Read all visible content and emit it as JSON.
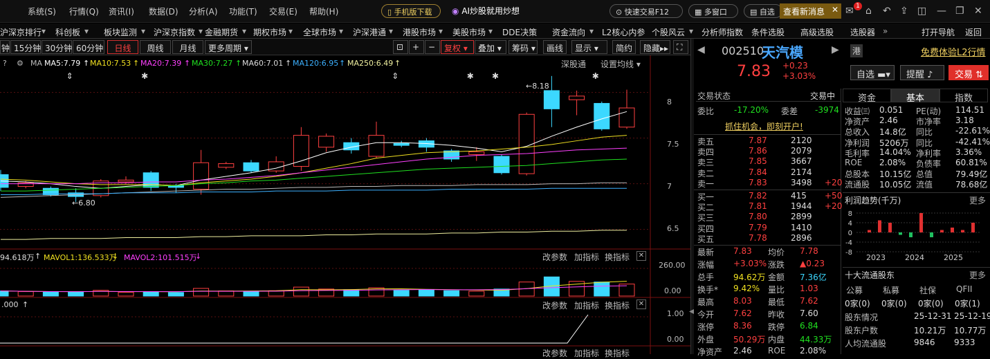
{
  "menubar": {
    "items": [
      "系统(S)",
      "行情(Q)",
      "资讯(I)",
      "数据(D)",
      "分析(A)",
      "功能(T)",
      "交易(E)",
      "帮助(H)"
    ],
    "mobile_btn": "手机版下载",
    "ai_btn": "AI炒股就用炒想",
    "fast_trade": "快速交易F12",
    "multi_window": "多窗口",
    "self_select": "自选",
    "new_msg": "查看新消息",
    "badge": "1"
  },
  "navbar": {
    "items": [
      "沪深京排行",
      "科创板",
      "板块监测",
      "沪深京指数",
      "金融期货",
      "期权市场",
      "全球市场",
      "沪深港通",
      "港股市场",
      "美股市场",
      "DDE决策",
      "资金流向",
      "L2核心内参",
      "个股风云",
      "分析师指数",
      "条件选股",
      "高级选股",
      "选股器",
      "打开导航",
      "返回"
    ]
  },
  "toolbar": {
    "periods": [
      "钟",
      "15分钟",
      "30分钟",
      "60分钟",
      "日线",
      "周线",
      "月线",
      "更多周期"
    ],
    "active": "日线",
    "tools": [
      "复权",
      "叠加",
      "筹码",
      "画线",
      "显示",
      "简约",
      "隐藏"
    ]
  },
  "ma_legend": {
    "ma": "MA",
    "ma5": "MA5:7.79",
    "ma10": "MA10:7.53",
    "ma20": "MA20:7.39",
    "ma30": "MA30:7.27",
    "ma60": "MA60:7.01",
    "ma120": "MA120:6.95",
    "ma250": "MA250:6.49",
    "shengutong": "深股通",
    "set_ma": "设置均线"
  },
  "chart_data": {
    "type": "candlestick",
    "ylim": [
      6.3,
      8.3
    ],
    "yticks": [
      8.0,
      7.5,
      7.0,
      6.5
    ],
    "high_label": "8.18",
    "low_label": "6.80",
    "candles": [
      {
        "o": 7.1,
        "c": 6.96,
        "h": 7.15,
        "l": 6.92
      },
      {
        "o": 6.97,
        "c": 7.01,
        "h": 7.03,
        "l": 6.95
      },
      {
        "o": 6.95,
        "c": 6.88,
        "h": 6.97,
        "l": 6.86
      },
      {
        "o": 6.9,
        "c": 6.86,
        "h": 6.95,
        "l": 6.8
      },
      {
        "o": 6.87,
        "c": 7.03,
        "h": 7.05,
        "l": 6.85
      },
      {
        "o": 7.02,
        "c": 7.04,
        "h": 7.08,
        "l": 7.0
      },
      {
        "o": 7.12,
        "c": 6.96,
        "h": 7.14,
        "l": 6.92
      },
      {
        "o": 6.98,
        "c": 6.96,
        "h": 7.0,
        "l": 6.9
      },
      {
        "o": 6.94,
        "c": 7.23,
        "h": 7.37,
        "l": 6.88
      },
      {
        "o": 7.18,
        "c": 7.22,
        "h": 7.24,
        "l": 7.16
      },
      {
        "o": 7.23,
        "c": 7.14,
        "h": 7.26,
        "l": 7.12
      },
      {
        "o": 7.14,
        "c": 7.24,
        "h": 7.3,
        "l": 7.12
      },
      {
        "o": 7.19,
        "c": 7.53,
        "h": 7.62,
        "l": 7.14
      },
      {
        "o": 7.4,
        "c": 7.52,
        "h": 7.55,
        "l": 7.35
      },
      {
        "o": 7.45,
        "c": 7.37,
        "h": 7.5,
        "l": 7.33
      },
      {
        "o": 7.3,
        "c": 7.53,
        "h": 7.68,
        "l": 7.28
      },
      {
        "o": 7.44,
        "c": 7.42,
        "h": 7.47,
        "l": 7.4
      },
      {
        "o": 7.47,
        "c": 7.4,
        "h": 7.5,
        "l": 7.35
      },
      {
        "o": 7.36,
        "c": 7.27,
        "h": 7.38,
        "l": 7.24
      },
      {
        "o": 7.32,
        "c": 7.35,
        "h": 7.4,
        "l": 7.25
      },
      {
        "o": 7.3,
        "c": 7.12,
        "h": 7.32,
        "l": 7.1
      },
      {
        "o": 7.11,
        "c": 7.76,
        "h": 7.78,
        "l": 7.09
      },
      {
        "o": 8.02,
        "c": 7.82,
        "h": 8.18,
        "l": 7.62
      },
      {
        "o": 7.92,
        "c": 7.96,
        "h": 8.02,
        "l": 7.75
      },
      {
        "o": 7.88,
        "c": 7.6,
        "h": 7.9,
        "l": 7.58
      },
      {
        "o": 7.62,
        "c": 7.83,
        "h": 8.03,
        "l": 7.6
      }
    ],
    "ma_lines": {
      "ma5": [
        7.03,
        7.02,
        7.0,
        6.97,
        6.95,
        6.97,
        6.99,
        6.98,
        7.04,
        7.08,
        7.12,
        7.17,
        7.25,
        7.34,
        7.4,
        7.45,
        7.45,
        7.44,
        7.42,
        7.39,
        7.35,
        7.41,
        7.52,
        7.62,
        7.71,
        7.79
      ],
      "ma10": [
        7.05,
        7.04,
        7.02,
        7.0,
        6.99,
        6.99,
        6.99,
        6.98,
        7.01,
        7.03,
        7.05,
        7.08,
        7.12,
        7.17,
        7.22,
        7.28,
        7.31,
        7.34,
        7.35,
        7.36,
        7.38,
        7.4,
        7.43,
        7.47,
        7.51,
        7.53
      ],
      "ma20": [
        7.0,
        7.0,
        7.0,
        7.0,
        7.01,
        7.01,
        7.02,
        7.02,
        7.04,
        7.05,
        7.07,
        7.09,
        7.12,
        7.15,
        7.18,
        7.21,
        7.24,
        7.27,
        7.29,
        7.31,
        7.32,
        7.33,
        7.35,
        7.37,
        7.38,
        7.39
      ],
      "ma30": [
        6.92,
        6.92,
        6.93,
        6.94,
        6.95,
        6.96,
        6.97,
        6.98,
        7.0,
        7.01,
        7.03,
        7.04,
        7.06,
        7.08,
        7.1,
        7.12,
        7.14,
        7.16,
        7.17,
        7.18,
        7.19,
        7.2,
        7.22,
        7.24,
        7.26,
        7.27
      ],
      "ma60": [
        6.85,
        6.86,
        6.87,
        6.88,
        6.89,
        6.9,
        6.91,
        6.92,
        6.93,
        6.94,
        6.94,
        6.95,
        6.96,
        6.96,
        6.97,
        6.97,
        6.98,
        6.98,
        6.98,
        6.99,
        6.99,
        6.99,
        7.0,
        7.0,
        7.01,
        7.01
      ],
      "ma120": [
        6.88,
        6.88,
        6.89,
        6.89,
        6.89,
        6.9,
        6.9,
        6.9,
        6.91,
        6.91,
        6.91,
        6.92,
        6.92,
        6.92,
        6.93,
        6.93,
        6.93,
        6.93,
        6.94,
        6.94,
        6.94,
        6.94,
        6.95,
        6.95,
        6.95,
        6.95
      ],
      "ma250": [
        6.39,
        6.39,
        6.4,
        6.4,
        6.4,
        6.41,
        6.41,
        6.41,
        6.42,
        6.42,
        6.43,
        6.43,
        6.43,
        6.44,
        6.44,
        6.45,
        6.45,
        6.45,
        6.46,
        6.46,
        6.47,
        6.47,
        6.48,
        6.48,
        6.49,
        6.49
      ]
    },
    "volume": [
      40,
      35,
      30,
      32,
      45,
      30,
      35,
      28,
      60,
      40,
      38,
      42,
      70,
      55,
      50,
      65,
      45,
      48,
      42,
      38,
      55,
      110,
      150,
      115,
      110,
      94
    ],
    "vol_ylim": [
      0,
      260
    ],
    "vol_ticks": [
      "260.00",
      "0.00"
    ],
    "ind_ticks": [
      "1.00",
      "0.00"
    ]
  },
  "vol_legend": {
    "vol": "94.618万",
    "mavol1": "MAVOL1:136.533万",
    "mavol2": "MAVOL2:101.515万",
    "change_param": "改参数",
    "add_ind": "加指标",
    "switch_ind": "换指标"
  },
  "ind_legend": {
    "val": ".000"
  },
  "stock": {
    "code": "002510",
    "name": "天汽模",
    "tag": "港",
    "price": "7.83",
    "change": "+0.23",
    "pct": "+3.03%",
    "l2_link": "免费体验L2行情",
    "btn_zixuan": "自选",
    "btn_remind": "提醒",
    "btn_trade": "交易"
  },
  "orderbook": {
    "status_label": "交易状态",
    "status_value": "交易中",
    "weibi_label": "委比",
    "weibi": "-17.20%",
    "weicha_label": "委差",
    "weicha": "-3974",
    "chance": "抓住机会，即刻开户!",
    "sells": [
      {
        "label": "卖五",
        "price": "7.87",
        "vol": "2120",
        "delta": ""
      },
      {
        "label": "卖四",
        "price": "7.86",
        "vol": "2079",
        "delta": ""
      },
      {
        "label": "卖三",
        "price": "7.85",
        "vol": "3667",
        "delta": ""
      },
      {
        "label": "卖二",
        "price": "7.84",
        "vol": "2174",
        "delta": ""
      },
      {
        "label": "卖一",
        "price": "7.83",
        "vol": "3498",
        "delta": "+20"
      }
    ],
    "buys": [
      {
        "label": "买一",
        "price": "7.82",
        "vol": "415",
        "delta": "+50"
      },
      {
        "label": "买二",
        "price": "7.81",
        "vol": "1944",
        "delta": "+20"
      },
      {
        "label": "买三",
        "price": "7.80",
        "vol": "2899",
        "delta": ""
      },
      {
        "label": "买四",
        "price": "7.79",
        "vol": "1410",
        "delta": ""
      },
      {
        "label": "买五",
        "price": "7.78",
        "vol": "2896",
        "delta": ""
      }
    ],
    "stats": [
      {
        "l1": "最新",
        "v1": "7.83",
        "c1": "red",
        "l2": "均价",
        "v2": "7.78",
        "c2": "red"
      },
      {
        "l1": "涨幅",
        "v1": "+3.03%",
        "c1": "red",
        "l2": "涨跌",
        "v2": "▲0.23",
        "c2": "red"
      },
      {
        "l1": "总手",
        "v1": "94.62万",
        "c1": "yellow",
        "l2": "金额",
        "v2": "7.36亿",
        "c2": "cyan"
      },
      {
        "l1": "换手*",
        "v1": "9.42%",
        "c1": "yellow",
        "l2": "量比",
        "v2": "1.03",
        "c2": "red"
      },
      {
        "l1": "最高",
        "v1": "8.03",
        "c1": "red",
        "l2": "最低",
        "v2": "7.62",
        "c2": "red"
      },
      {
        "l1": "今开",
        "v1": "7.62",
        "c1": "red",
        "l2": "昨收",
        "v2": "7.60",
        "c2": "white"
      },
      {
        "l1": "涨停",
        "v1": "8.36",
        "c1": "red",
        "l2": "跌停",
        "v2": "6.84",
        "c2": "green"
      },
      {
        "l1": "外盘",
        "v1": "50.29万",
        "c1": "red",
        "l2": "内盘",
        "v2": "44.33万",
        "c2": "green"
      },
      {
        "l1": "净资产",
        "v1": "2.46",
        "c1": "white",
        "l2": "ROE",
        "v2": "2.08%",
        "c2": "white"
      }
    ]
  },
  "fund": {
    "tabs": [
      "资金",
      "基本",
      "指数"
    ],
    "active_tab": "基本",
    "rows": [
      {
        "l1": "收益㈢",
        "v1": "0.051",
        "l2": "PE(动)",
        "v2": "114.51"
      },
      {
        "l1": "净资产",
        "v1": "2.46",
        "l2": "市净率",
        "v2": "3.18"
      },
      {
        "l1": "总收入",
        "v1": "14.8亿",
        "l2": "同比",
        "v2": "-22.61%"
      },
      {
        "l1": "净利润",
        "v1": "5206万",
        "l2": "同比",
        "v2": "-42.41%"
      },
      {
        "l1": "毛利率",
        "v1": "14.04%",
        "l2": "净利率",
        "v2": "3.36%"
      },
      {
        "l1": "ROE",
        "v1": "2.08%",
        "l2": "负债率",
        "v2": "60.81%"
      },
      {
        "l1": "总股本",
        "v1": "10.15亿",
        "l2": "总值",
        "v2": "79.49亿"
      },
      {
        "l1": "流通股",
        "v1": "10.05亿",
        "l2": "流值",
        "v2": "78.68亿"
      }
    ],
    "profit_title": "利润趋势(千万)",
    "more": "更多",
    "profit_yticks": [
      "8",
      "4",
      "0",
      "-4",
      "-8"
    ],
    "profit_years": [
      "2023",
      "2024",
      "2025"
    ],
    "profit_values": [
      1,
      5,
      4,
      -1,
      -2,
      8,
      -2,
      1,
      2,
      1,
      4
    ],
    "holders_title": "十大流通股东",
    "holder_cols": [
      "公募",
      "私募",
      "社保",
      "QFII"
    ],
    "holder_vals": [
      "0家(0)",
      "0家(0)",
      "0家(0)",
      "0家(1)"
    ],
    "holder_info": [
      {
        "label": "股东情况",
        "v1": "25-12-31",
        "v2": "25-12-19"
      },
      {
        "label": "股东户数",
        "v1": "10.21万",
        "v2": "10.77万"
      },
      {
        "label": "人均流通股",
        "v1": "9846",
        "v2": "9333"
      }
    ]
  },
  "colors": {
    "up": "#ff4040",
    "down": "#3cd8ff",
    "ma5": "#ffffff",
    "ma10": "#f0e020",
    "ma20": "#ff40ff",
    "ma30": "#20e020",
    "ma60": "#bbbbbb",
    "ma120": "#3cb0ff",
    "ma250": "#f0f0a0"
  }
}
